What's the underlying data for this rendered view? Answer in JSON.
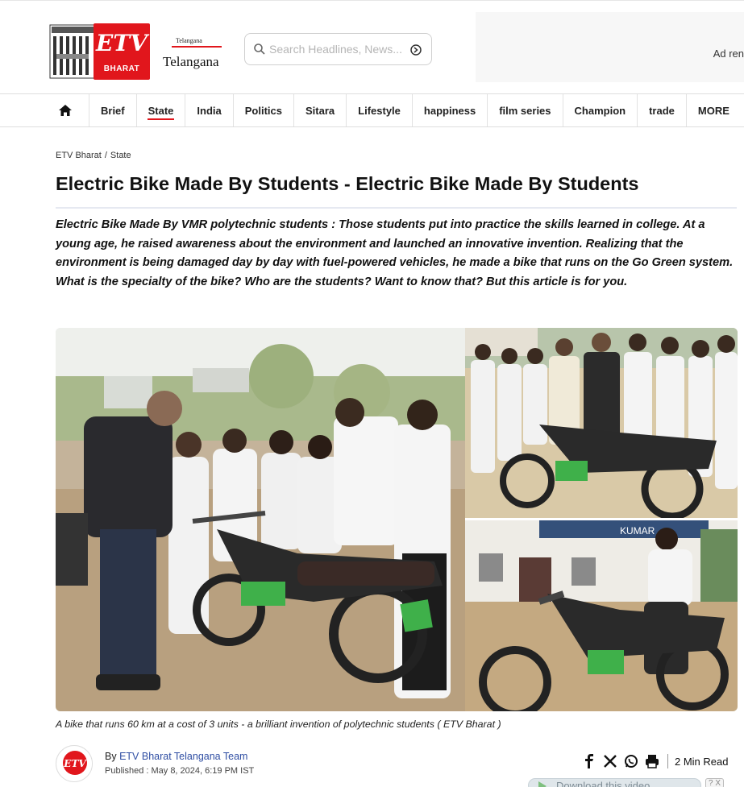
{
  "header": {
    "state_small": "Telangana",
    "state_big": "Telangana",
    "logo_text": "ETV",
    "logo_sub": "BHARAT",
    "search_placeholder": "Search Headlines, News...",
    "ad_text": "Ad ren"
  },
  "nav": {
    "items": [
      {
        "label": "Brief"
      },
      {
        "label": "State"
      },
      {
        "label": "India"
      },
      {
        "label": "Politics"
      },
      {
        "label": "Sitara"
      },
      {
        "label": "Lifestyle"
      },
      {
        "label": "happiness"
      },
      {
        "label": "film series"
      },
      {
        "label": "Champion"
      },
      {
        "label": "trade"
      },
      {
        "label": "MORE"
      }
    ],
    "active": "State"
  },
  "breadcrumb": {
    "home": "ETV Bharat",
    "separator": "/",
    "section": "State"
  },
  "article": {
    "title": "Electric Bike Made By Students - Electric Bike Made By Students",
    "summary": "Electric Bike Made By VMR polytechnic students : Those students put into practice the skills learned in college. At a young age, he raised awareness about the environment and launched an innovative invention. Realizing that the environment is being damaged day by day with fuel-powered vehicles, he made a bike that runs on the Go Green system. What is the specialty of the bike? Who are the students? Want to know that? But this article is for you.",
    "caption": "A bike that runs 60 km at a cost of 3 units - a brilliant invention of polytechnic students ( ETV Bharat )",
    "author_prefix": "By",
    "author": "ETV Bharat Telangana Team",
    "published": "Published : May 8, 2024, 6:19 PM IST",
    "read_time": "2 Min Read",
    "download_label": "Download this video",
    "mini_buttons": "? X",
    "photo_sign_text": "KUMAR"
  },
  "colors": {
    "brand_red": "#e1161c",
    "link_blue": "#2f4ea3",
    "bike_green": "#3fb04a"
  },
  "icons": {
    "home": "home-icon",
    "search": "search-icon",
    "go": "go-icon",
    "facebook": "facebook-icon",
    "x": "x-icon",
    "whatsapp": "whatsapp-icon",
    "print": "print-icon"
  }
}
